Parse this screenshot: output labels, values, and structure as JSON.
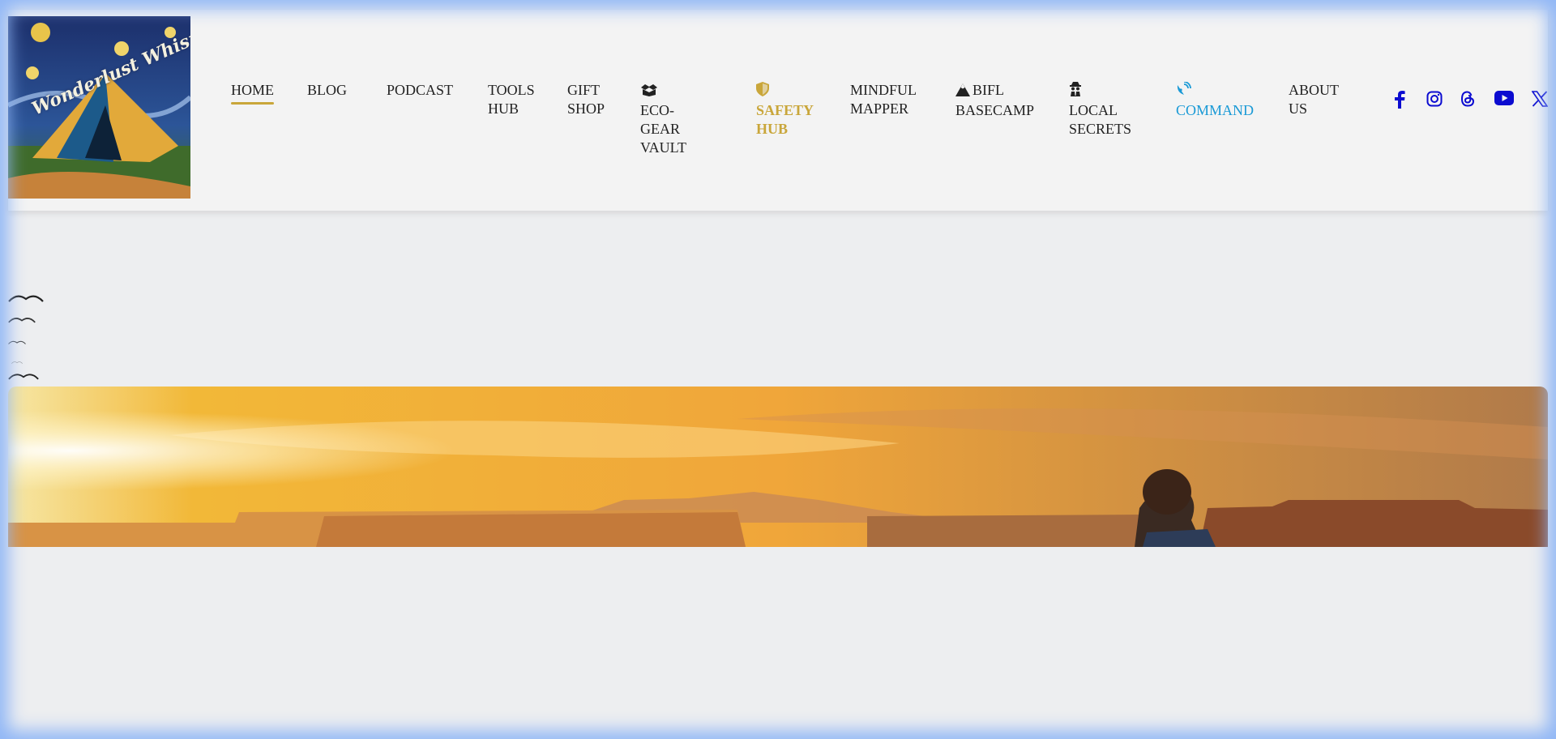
{
  "brand": {
    "logo_text": "Wonderlust Whispers"
  },
  "nav": [
    {
      "id": "home",
      "lines": [
        "HOME"
      ],
      "icon": null
    },
    {
      "id": "blog",
      "lines": [
        "BLOG"
      ],
      "icon": null
    },
    {
      "id": "podcast",
      "lines": [
        "PODCAST"
      ],
      "icon": null
    },
    {
      "id": "tools-hub",
      "lines": [
        "TOOLS",
        "HUB"
      ],
      "icon": null
    },
    {
      "id": "gift-shop",
      "lines": [
        "GIFT",
        "SHOP"
      ],
      "icon": null
    },
    {
      "id": "eco-gear-vault",
      "lines": [
        "ECO-",
        "GEAR",
        "VAULT"
      ],
      "icon": "box-open-icon"
    },
    {
      "id": "safety-hub",
      "lines": [
        "SAFETY",
        "HUB"
      ],
      "icon": "shield-icon"
    },
    {
      "id": "mindful-mapper",
      "lines": [
        "MINDFUL",
        "MAPPER"
      ],
      "icon": null
    },
    {
      "id": "bifl-basecamp",
      "lines": [
        "BIFL",
        "BASECAMP"
      ],
      "icon": "mountain-icon"
    },
    {
      "id": "local-secrets",
      "lines": [
        "LOCAL",
        "SECRETS"
      ],
      "icon": "spy-icon"
    },
    {
      "id": "command",
      "lines": [
        "COMMAND"
      ],
      "icon": "satellite-dish-icon"
    },
    {
      "id": "about-us",
      "lines": [
        "ABOUT",
        "US"
      ],
      "icon": null
    }
  ],
  "social": [
    {
      "id": "facebook",
      "icon": "facebook-icon"
    },
    {
      "id": "instagram",
      "icon": "instagram-icon"
    },
    {
      "id": "threads",
      "icon": "threads-icon"
    },
    {
      "id": "youtube",
      "icon": "youtube-icon"
    },
    {
      "id": "x",
      "icon": "x-icon"
    }
  ],
  "colors": {
    "accent_gold": "#c9a63a",
    "command_blue": "#1a9ad6",
    "social_blue": "#0b0bd0",
    "header_bg": "#f3f3f3",
    "page_bg": "#edeef0",
    "frame_glow": "#8fb6f6"
  },
  "birds": {
    "icon": "bird-flock-icon",
    "count": 5
  },
  "hero": {
    "image": "canyon-sunset-hero-image"
  }
}
